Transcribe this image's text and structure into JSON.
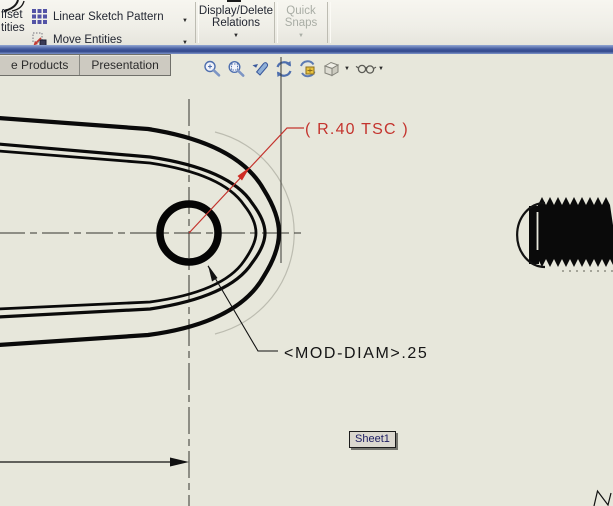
{
  "toolbar": {
    "offset_partial": {
      "line1": "ffset",
      "line2": "tities"
    },
    "linear_sketch_pattern": "Linear Sketch Pattern",
    "move_entities": "Move Entities",
    "display_delete": {
      "line1": "Display/Delete",
      "line2": "Relations"
    },
    "quick_snaps": {
      "line1": "Quick",
      "line2": "Snaps"
    }
  },
  "tabs": [
    {
      "label": "e Products"
    },
    {
      "label": "Presentation"
    }
  ],
  "view_toolbar": {
    "icons": [
      "zoom-in-out",
      "zoom-to-area",
      "zoom-to-selection",
      "rotate-view",
      "3d-drawing-view",
      "view-orientation",
      "display-style"
    ]
  },
  "drawing": {
    "radius_dimension": "( R.40 TSC )",
    "diameter_dimension": "<MOD-DIAM>.25",
    "sheet_label": "Sheet1"
  },
  "colors": {
    "dimension_red": "#c4342e",
    "drawing_background": "#e7e7db",
    "geometry_black": "#0a0a0a",
    "toolbar_strip_blue": "#3a559c",
    "disabled_text": "#a9ada5"
  }
}
